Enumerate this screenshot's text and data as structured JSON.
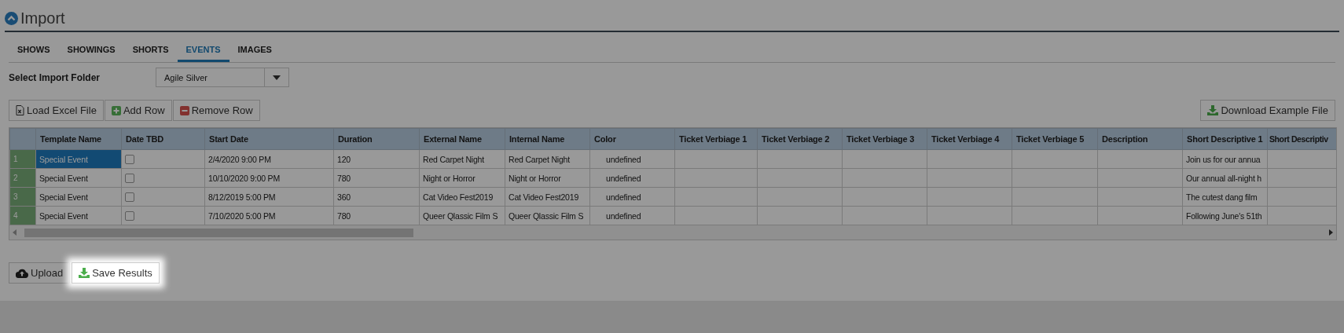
{
  "dimmed": true,
  "page": {
    "title": "Import"
  },
  "tabs": [
    {
      "label": "SHOWS",
      "selected": false
    },
    {
      "label": "SHOWINGS",
      "selected": false
    },
    {
      "label": "SHORTS",
      "selected": false
    },
    {
      "label": "EVENTS",
      "selected": true
    },
    {
      "label": "IMAGES",
      "selected": false
    }
  ],
  "import_folder": {
    "label": "Select Import Folder",
    "value": "Agile Silver"
  },
  "toolbar": {
    "left": [
      {
        "label": "Load Excel File",
        "kind": "excel"
      },
      {
        "label": "Add Row",
        "kind": "add"
      },
      {
        "label": "Remove Row",
        "kind": "remove"
      }
    ],
    "right": [
      {
        "label": "Download Example File",
        "kind": "download"
      }
    ]
  },
  "table": {
    "columns": [
      "Template Name",
      "Date TBD",
      "Start Date",
      "Duration",
      "External Name",
      "Internal Name",
      "Color",
      "Ticket Verbiage 1",
      "Ticket Verbiage 2",
      "Ticket Verbiage 3",
      "Ticket Verbiage 4",
      "Ticket Verbiage 5",
      "Description",
      "Short Descriptive 1",
      "Short Descriptiv"
    ],
    "rows": [
      {
        "number": "1",
        "selected": true,
        "date_tbd": false,
        "template_name": "Special Event",
        "start_date": "2/4/2020 9:00 PM",
        "duration": "120",
        "external_name": "Red Carpet Night",
        "internal_name": "Red Carpet Night",
        "color_name": "undefined",
        "short_descriptive_1": "Join us for our annua"
      },
      {
        "number": "2",
        "selected": false,
        "date_tbd": false,
        "template_name": "Special Event",
        "start_date": "10/10/2020 9:00 PM",
        "duration": "780",
        "external_name": "Night or Horror",
        "internal_name": "Night or Horror",
        "color_name": "undefined",
        "short_descriptive_1": "Our annual all-night h"
      },
      {
        "number": "3",
        "selected": false,
        "date_tbd": false,
        "template_name": "Special Event",
        "start_date": "8/12/2019 5:00 PM",
        "duration": "360",
        "external_name": "Cat Video Fest2019",
        "internal_name": "Cat Video Fest2019",
        "color_name": "undefined",
        "short_descriptive_1": "The cutest dang film"
      },
      {
        "number": "4",
        "selected": false,
        "date_tbd": false,
        "template_name": "Special Event",
        "start_date": "7/10/2020 5:00 PM",
        "duration": "780",
        "external_name": "Queer Qlassic Film S",
        "internal_name": "Queer Qlassic Film S",
        "color_name": "undefined",
        "short_descriptive_1": "Following June's 51th"
      }
    ]
  },
  "footer": [
    {
      "label": "Upload",
      "kind": "upload",
      "highlighted": false
    },
    {
      "label": "Save Results",
      "kind": "save",
      "highlighted": true
    }
  ]
}
